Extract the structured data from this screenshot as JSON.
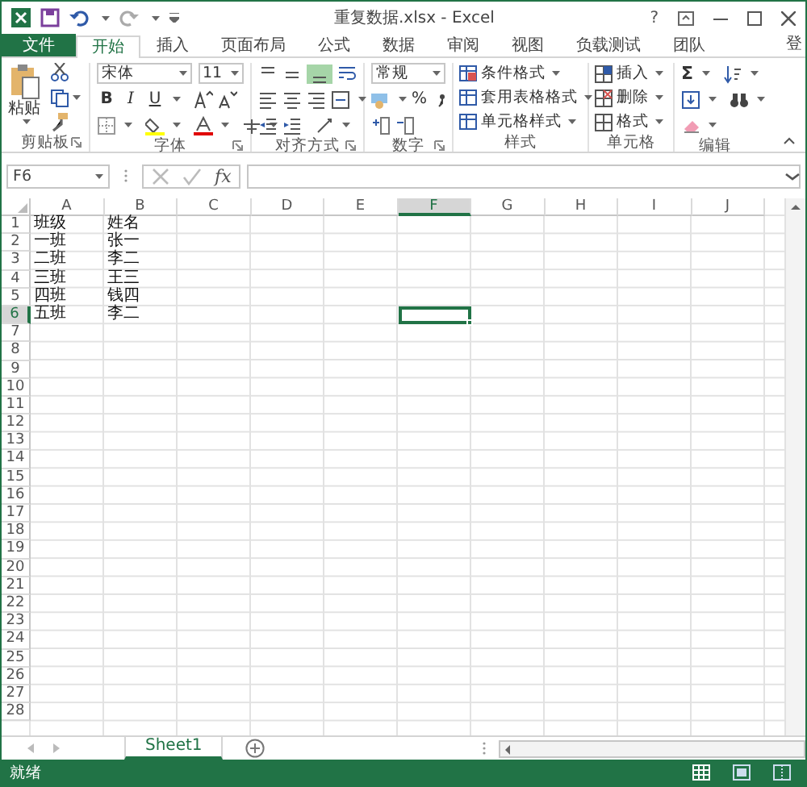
{
  "window": {
    "title": "重复数据.xlsx - Excel",
    "help": "?",
    "account": "登"
  },
  "tabs": [
    {
      "label": "文件",
      "kind": "file",
      "selected": false
    },
    {
      "label": "开始",
      "kind": "tab",
      "selected": true
    },
    {
      "label": "插入",
      "kind": "tab",
      "selected": false
    },
    {
      "label": "页面布局",
      "kind": "tab",
      "selected": false
    },
    {
      "label": "公式",
      "kind": "tab",
      "selected": false
    },
    {
      "label": "数据",
      "kind": "tab",
      "selected": false
    },
    {
      "label": "审阅",
      "kind": "tab",
      "selected": false
    },
    {
      "label": "视图",
      "kind": "tab",
      "selected": false
    },
    {
      "label": "负载测试",
      "kind": "tab",
      "selected": false
    },
    {
      "label": "团队",
      "kind": "tab",
      "selected": false
    }
  ],
  "ribbon": {
    "clipboard": {
      "paste": "粘贴",
      "label": "剪贴板"
    },
    "font": {
      "font_name": "宋体",
      "font_size": "11",
      "style_buttons": [
        "B",
        "I",
        "U"
      ],
      "label": "字体"
    },
    "alignment": {
      "label": "对齐方式"
    },
    "number": {
      "format": "常规",
      "percent": "%",
      "label": "数字"
    },
    "styles": {
      "items": [
        "条件格式",
        "套用表格格式",
        "单元格样式"
      ],
      "label": "样式"
    },
    "cells": {
      "items": [
        "插入",
        "删除",
        "格式"
      ],
      "label": "单元格"
    },
    "editing": {
      "sum": "Σ",
      "label": "编辑"
    }
  },
  "formula_bar": {
    "name_box": "F6",
    "function_label": "fx"
  },
  "sheet": {
    "columns": [
      {
        "label": "A",
        "selected": false
      },
      {
        "label": "B",
        "selected": false
      },
      {
        "label": "C",
        "selected": false
      },
      {
        "label": "D",
        "selected": false
      },
      {
        "label": "E",
        "selected": false
      },
      {
        "label": "F",
        "selected": true
      },
      {
        "label": "G",
        "selected": false
      },
      {
        "label": "H",
        "selected": false
      },
      {
        "label": "I",
        "selected": false
      },
      {
        "label": "J",
        "selected": false
      }
    ],
    "rows": [
      {
        "number": "1",
        "selected": false,
        "cells": [
          "班级",
          "姓名"
        ]
      },
      {
        "number": "2",
        "selected": false,
        "cells": [
          "一班",
          "张一"
        ]
      },
      {
        "number": "3",
        "selected": false,
        "cells": [
          "二班",
          "李二"
        ]
      },
      {
        "number": "4",
        "selected": false,
        "cells": [
          "三班",
          "王三"
        ]
      },
      {
        "number": "5",
        "selected": false,
        "cells": [
          "四班",
          "钱四"
        ]
      },
      {
        "number": "6",
        "selected": true,
        "cells": [
          "五班",
          "李二"
        ]
      },
      {
        "number": "7",
        "selected": false
      },
      {
        "number": "8",
        "selected": false
      },
      {
        "number": "9",
        "selected": false
      },
      {
        "number": "10",
        "selected": false
      },
      {
        "number": "11",
        "selected": false
      },
      {
        "number": "12",
        "selected": false
      },
      {
        "number": "13",
        "selected": false
      },
      {
        "number": "14",
        "selected": false
      },
      {
        "number": "15",
        "selected": false
      },
      {
        "number": "16",
        "selected": false
      },
      {
        "number": "17",
        "selected": false
      },
      {
        "number": "18",
        "selected": false
      },
      {
        "number": "19",
        "selected": false
      },
      {
        "number": "20",
        "selected": false
      },
      {
        "number": "21",
        "selected": false
      },
      {
        "number": "22",
        "selected": false
      },
      {
        "number": "23",
        "selected": false
      },
      {
        "number": "24",
        "selected": false
      },
      {
        "number": "25",
        "selected": false
      },
      {
        "number": "26",
        "selected": false
      },
      {
        "number": "27",
        "selected": false
      },
      {
        "number": "28",
        "selected": false
      }
    ]
  },
  "sheet_tabs": [
    {
      "label": "Sheet1",
      "selected": true
    }
  ],
  "status_bar": {
    "text": "就绪"
  }
}
